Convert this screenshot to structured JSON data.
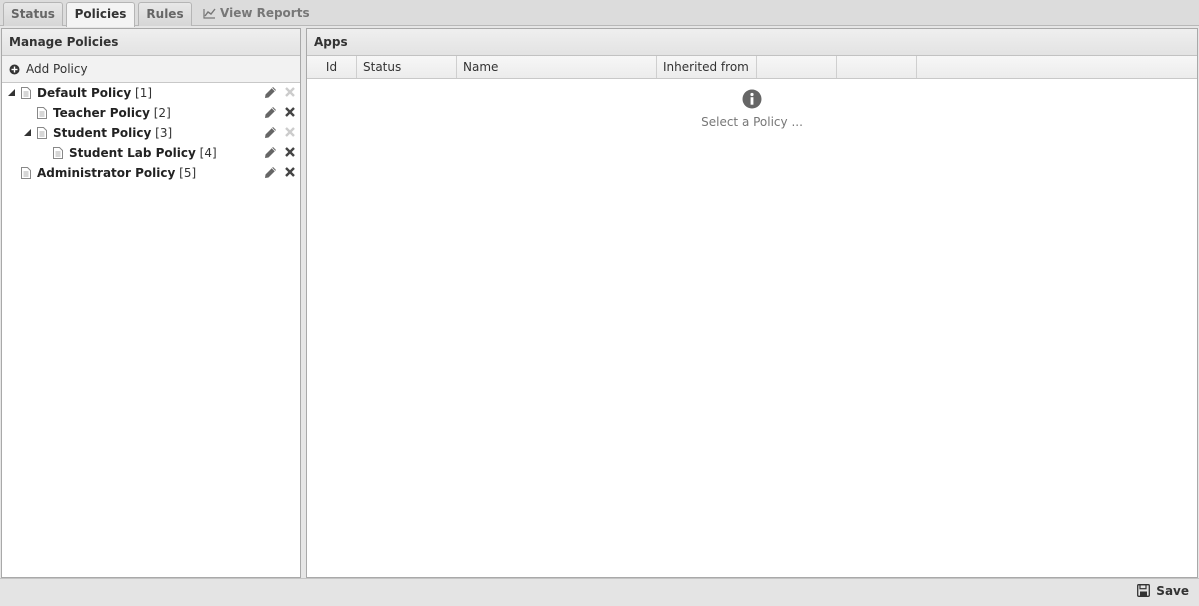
{
  "tabs": [
    {
      "label": "Status"
    },
    {
      "label": "Policies"
    },
    {
      "label": "Rules"
    }
  ],
  "reports_tab": {
    "label": "View Reports",
    "icon": "chart-line-icon"
  },
  "left_panel": {
    "title": "Manage Policies",
    "add_label": "Add Policy",
    "policies": [
      {
        "name": "Default Policy",
        "id_text": "[1]",
        "level": 0,
        "expanded": true,
        "deletable": false
      },
      {
        "name": "Teacher Policy",
        "id_text": "[2]",
        "level": 1,
        "expanded": false,
        "deletable": true
      },
      {
        "name": "Student Policy",
        "id_text": "[3]",
        "level": 1,
        "expanded": true,
        "deletable": false
      },
      {
        "name": "Student Lab Policy",
        "id_text": "[4]",
        "level": 2,
        "expanded": false,
        "deletable": true
      },
      {
        "name": "Administrator Policy",
        "id_text": "[5]",
        "level": 0,
        "expanded": false,
        "deletable": true
      }
    ]
  },
  "right_panel": {
    "title": "Apps",
    "columns": [
      "Id",
      "Status",
      "Name",
      "Inherited from",
      "",
      ""
    ],
    "empty_text": "Select a Policy ..."
  },
  "footer": {
    "save_label": "Save"
  },
  "colors": {
    "icon_gray": "#666666",
    "disabled_icon": "#cccccc"
  }
}
